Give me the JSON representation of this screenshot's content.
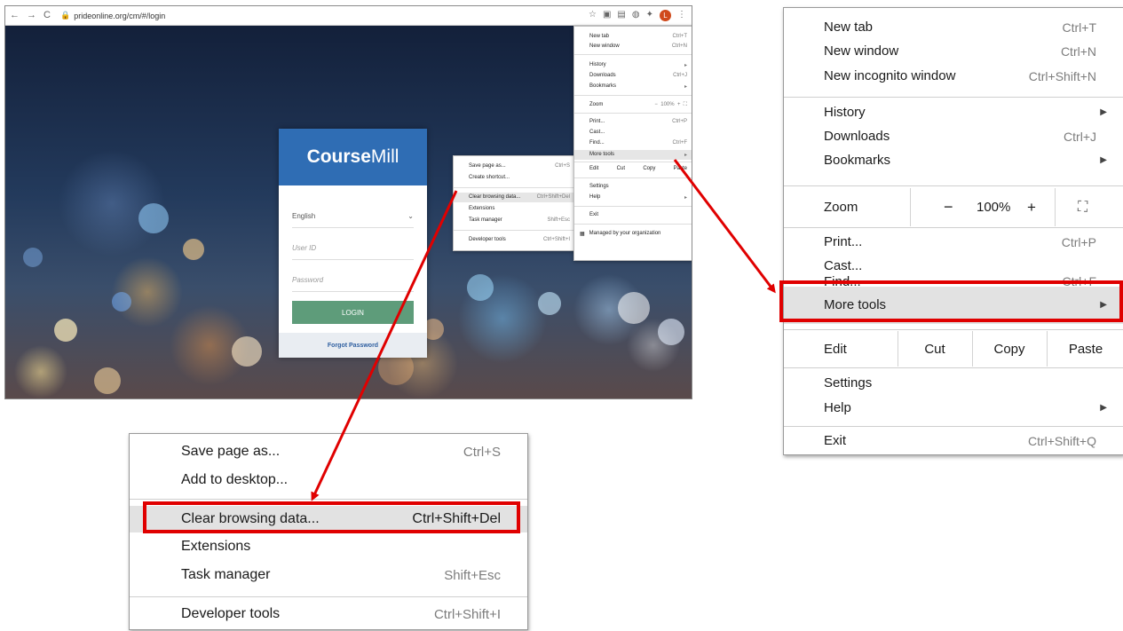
{
  "browser": {
    "url": "prideonline.org/cm/#/login",
    "nav_icons": [
      "back-arrow-icon",
      "forward-arrow-icon",
      "reload-icon"
    ],
    "profile_initial": "L"
  },
  "login_card": {
    "brand_bold": "Course",
    "brand_light": "Mill",
    "language": "English",
    "userid_placeholder": "User ID",
    "password_placeholder": "Password",
    "login_label": "LOGIN",
    "forgot_label": "Forgot Password"
  },
  "chrome_menu": {
    "new_tab": {
      "label": "New tab",
      "key": "Ctrl+T"
    },
    "new_window": {
      "label": "New window",
      "key": "Ctrl+N"
    },
    "new_incognito": {
      "label": "New incognito window",
      "key": "Ctrl+Shift+N"
    },
    "history": {
      "label": "History"
    },
    "downloads": {
      "label": "Downloads",
      "key": "Ctrl+J"
    },
    "bookmarks": {
      "label": "Bookmarks"
    },
    "zoom": {
      "label": "Zoom",
      "minus": "−",
      "value": "100%",
      "plus": "+"
    },
    "print": {
      "label": "Print...",
      "key": "Ctrl+P"
    },
    "cast": {
      "label": "Cast..."
    },
    "find": {
      "label": "Find...",
      "key": "Ctrl+F"
    },
    "more_tools": {
      "label": "More tools"
    },
    "edit": {
      "label": "Edit",
      "cut": "Cut",
      "copy": "Copy",
      "paste": "Paste"
    },
    "settings": {
      "label": "Settings"
    },
    "help": {
      "label": "Help"
    },
    "exit": {
      "label": "Exit",
      "key": "Ctrl+Shift+Q"
    },
    "managed": {
      "label": "Managed by your organization"
    }
  },
  "mini_menu": {
    "new_tab_key": "Ctrl+T",
    "new_window_key": "Ctrl+N",
    "downloads_key": "Ctrl+J",
    "zoom_value": "100%",
    "print_key": "Ctrl+P",
    "cast_label": "Cast...",
    "find_label": "Find...",
    "find_key": "Ctrl+F",
    "exit_label": "Exit",
    "paste_label": "Paste"
  },
  "more_tools_menu": {
    "save_page": {
      "label": "Save page as...",
      "key": "Ctrl+S"
    },
    "add_desktop": {
      "label": "Add to desktop..."
    },
    "create_shortcut": {
      "label": "Create shortcut..."
    },
    "clear_data": {
      "label": "Clear browsing data...",
      "key": "Ctrl+Shift+Del"
    },
    "extensions": {
      "label": "Extensions"
    },
    "task_manager": {
      "label": "Task manager",
      "key": "Shift+Esc"
    },
    "dev_tools": {
      "label": "Developer tools",
      "key": "Ctrl+Shift+I"
    }
  },
  "highlight_color": "#e00000"
}
